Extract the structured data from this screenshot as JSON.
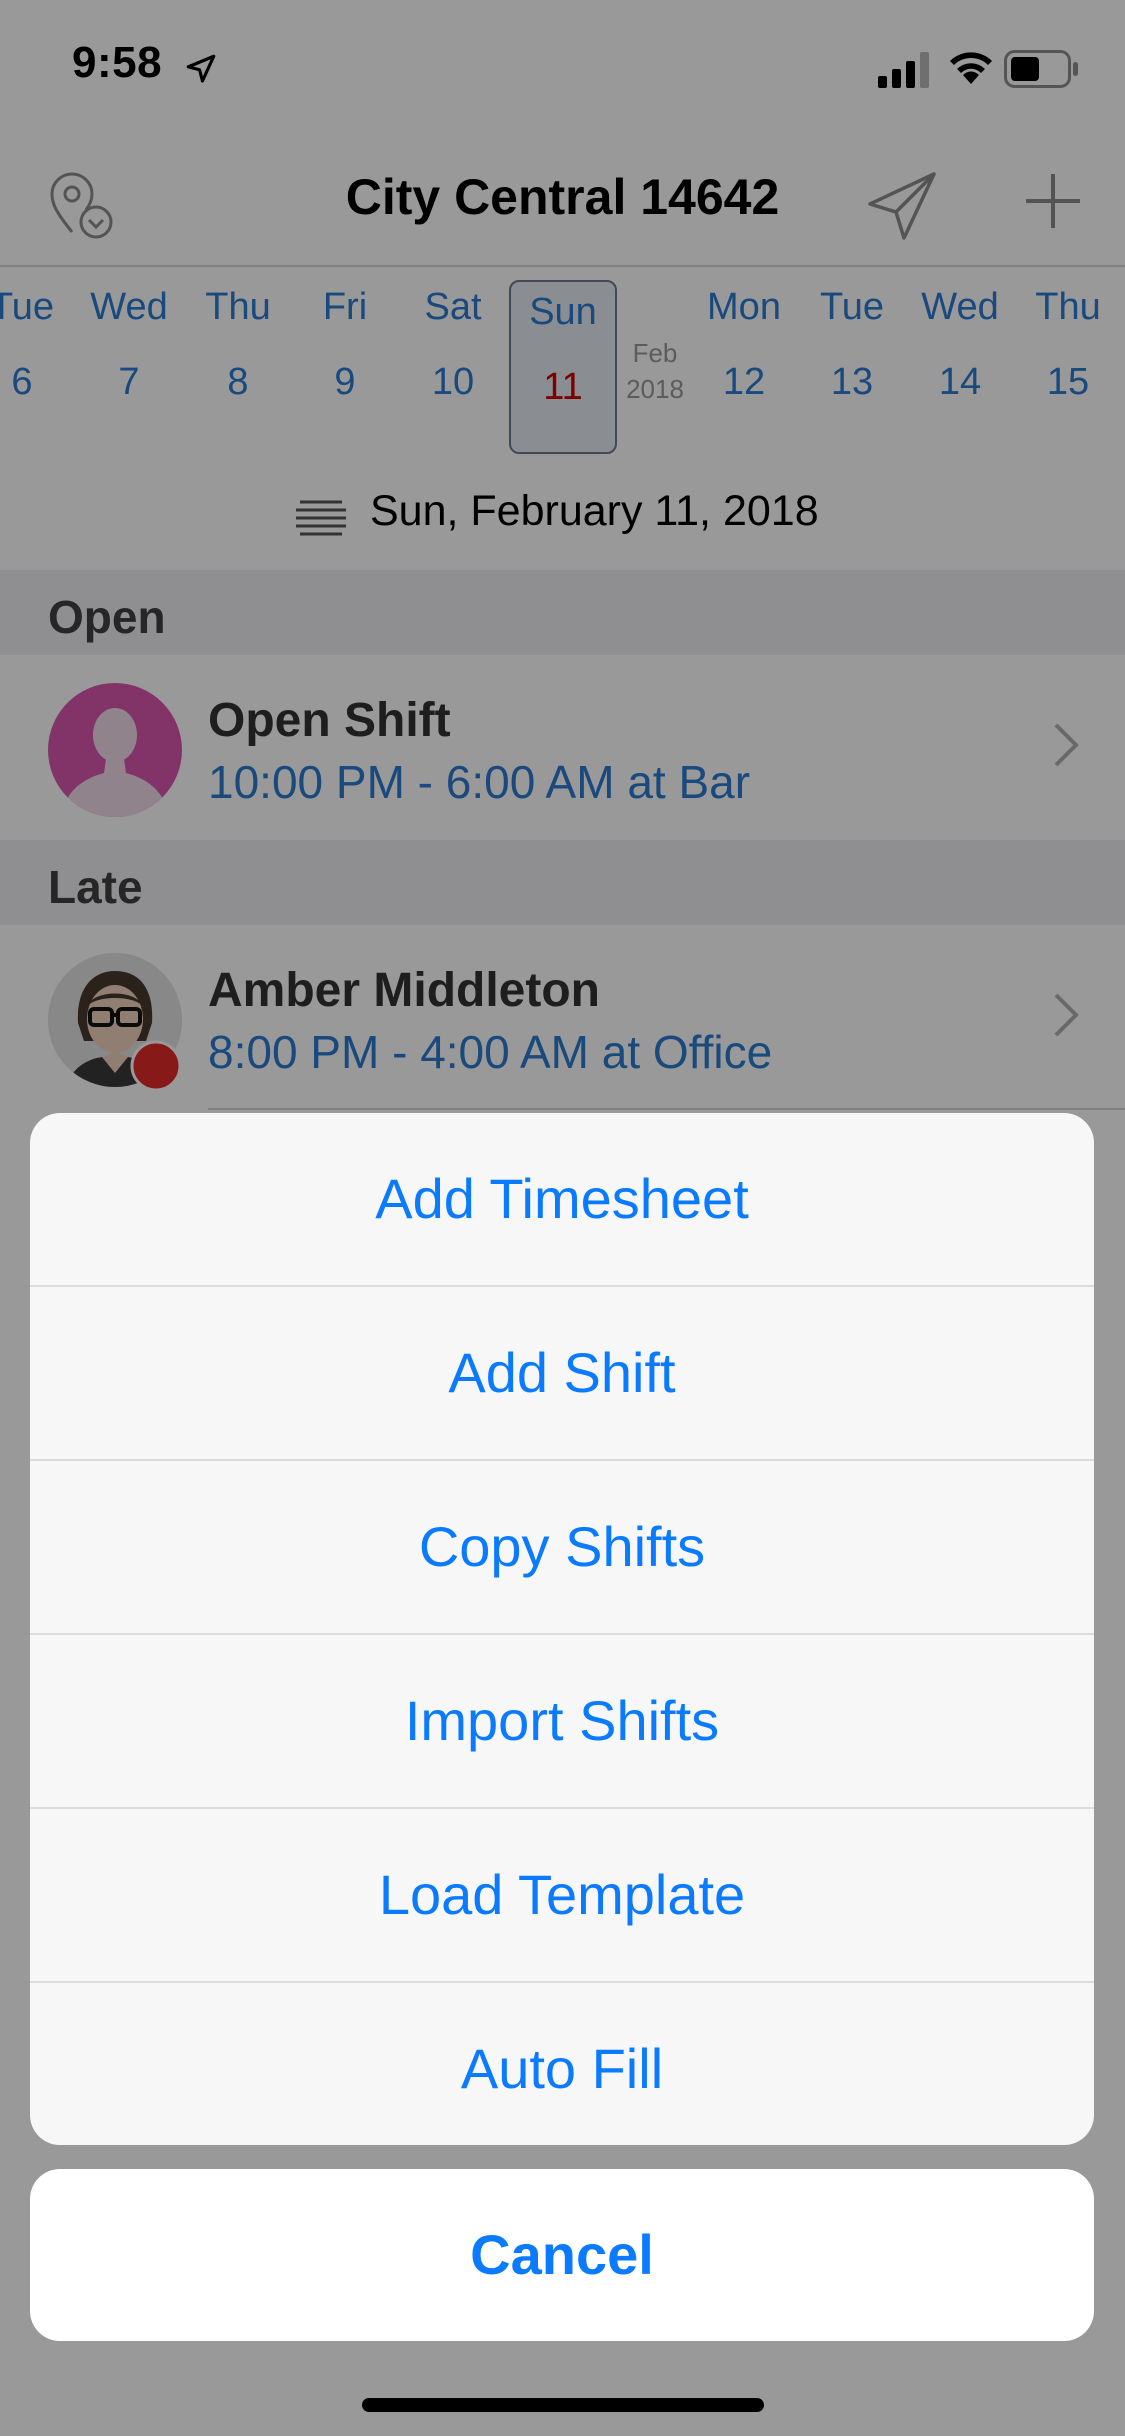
{
  "status_bar": {
    "time": "9:58"
  },
  "nav": {
    "title": "City Central 14642"
  },
  "week": {
    "days": [
      {
        "name": "Tue",
        "num": "6"
      },
      {
        "name": "Wed",
        "num": "7"
      },
      {
        "name": "Thu",
        "num": "8"
      },
      {
        "name": "Fri",
        "num": "9"
      },
      {
        "name": "Sat",
        "num": "10"
      },
      {
        "name": "Sun",
        "num": "11"
      },
      {
        "name": "Mon",
        "num": "12"
      },
      {
        "name": "Tue",
        "num": "13"
      },
      {
        "name": "Wed",
        "num": "14"
      },
      {
        "name": "Thu",
        "num": "15"
      }
    ],
    "month": "Feb",
    "year": "2018",
    "selected_date": "Sun, February 11, 2018"
  },
  "sections": [
    {
      "header": "Open",
      "name": "Open Shift",
      "detail": "10:00 PM - 6:00 AM at Bar"
    },
    {
      "header": "Late",
      "name": "Amber Middleton",
      "detail": "8:00 PM - 4:00 AM at Office"
    }
  ],
  "action_sheet": {
    "items": [
      "Add Timesheet",
      "Add Shift",
      "Copy Shifts",
      "Import Shifts",
      "Load Template",
      "Auto Fill"
    ],
    "cancel": "Cancel"
  },
  "colors": {
    "accent": "#0a7aff",
    "link": "#2a7bd0",
    "selected_day": "#d00000",
    "open_avatar": "#d957b0"
  },
  "icons": [
    "location-arrow-icon",
    "cellular-signal-icon",
    "wifi-icon",
    "battery-icon",
    "location-pin-icon",
    "send-icon",
    "plus-icon",
    "list-icon",
    "person-placeholder-icon",
    "chevron-right-icon"
  ]
}
